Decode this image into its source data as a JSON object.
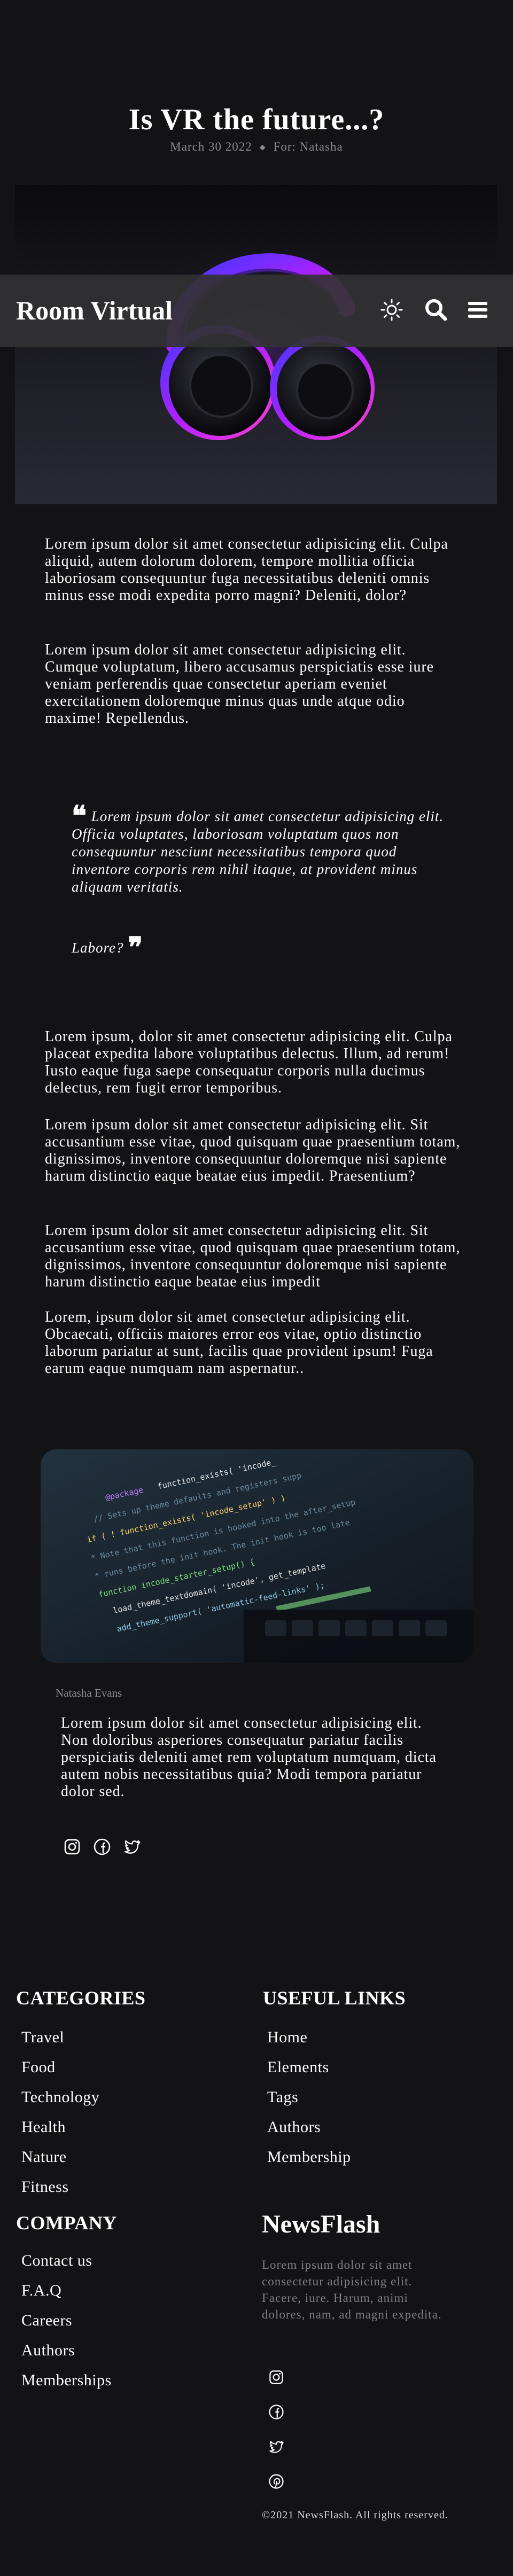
{
  "post": {
    "title": "Is VR the future...?",
    "date": "March 30 2022",
    "separator": "◆",
    "author_line": "For: Natasha"
  },
  "navbar": {
    "brand": "Room Virtual",
    "icons": [
      "theme-toggle-icon",
      "search-icon",
      "menu-icon"
    ]
  },
  "article": {
    "paragraphs": [
      "Lorem ipsum dolor sit amet consectetur adipisicing elit. Culpa aliquid, autem dolorum dolorem, tempore mollitia officia laboriosam consequuntur fuga necessitatibus deleniti omnis minus esse modi expedita porro magni? Deleniti, dolor?",
      "Lorem ipsum dolor sit amet consectetur adipisicing elit. Cumque voluptatum, libero accusamus perspiciatis esse iure veniam perferendis quae consectetur aperiam eveniet exercitationem doloremque minus quas unde atque odio maxime! Repellendus."
    ],
    "quote": "Lorem ipsum dolor sit amet consectetur adipisicing elit. Officia voluptates, laboriosam voluptatum quos non consequuntur nesciunt necessitatibus tempora quod inventore corporis rem nihil itaque, at provident minus aliquam veritatis.",
    "quote_end": "Labore?",
    "quote_open": "❝",
    "quote_close": "❞",
    "paragraphs2": [
      "Lorem ipsum, dolor sit amet consectetur adipisicing elit. Culpa placeat expedita labore voluptatibus delectus. Illum, ad rerum! Iusto eaque fuga saepe consequatur corporis nulla ducimus delectus, rem fugit error temporibus.",
      "Lorem ipsum dolor sit amet consectetur adipisicing elit. Sit accusantium esse vitae, quod quisquam quae praesentium totam, dignissimos, inventore consequuntur doloremque nisi sapiente harum distinctio eaque beatae eius impedit. Praesentium?",
      "Lorem ipsum dolor sit amet consectetur adipisicing elit. Sit accusantium esse vitae, quod quisquam quae praesentium totam, dignissimos, inventore consequuntur doloremque nisi sapiente harum distinctio eaque beatae eius impedit",
      "Lorem, ipsum dolor sit amet consectetur adipisicing elit. Obcaecati, officiis maiores error eos vitae, optio distinctio laborum pariatur at sunt, facilis quae provident ipsum! Fuga earum eaque numquam nam aspernatur.."
    ]
  },
  "author": {
    "name": "Natasha Evans",
    "bio": "Lorem ipsum dolor sit amet consectetur adipisicing elit. Non doloribus asperiores consequatur pariatur facilis perspiciatis deleniti amet rem voluptatum numquam, dicta autem nobis necessitatibus quia? Modi tempora pariatur dolor sed.",
    "social_icons": [
      "instagram-icon",
      "facebook-icon",
      "twitter-icon"
    ]
  },
  "footer": {
    "categories": {
      "heading": "CATEGORIES",
      "items": [
        "Travel",
        "Food",
        "Technology",
        "Health",
        "Nature",
        "Fitness"
      ]
    },
    "useful_links": {
      "heading": "USEFUL LINKS",
      "items": [
        "Home",
        "Elements",
        "Tags",
        "Authors",
        "Membership"
      ]
    },
    "company": {
      "heading": "COMPANY",
      "items": [
        "Contact us",
        "F.A.Q",
        "Careers",
        "Authors",
        "Memberships"
      ]
    },
    "newsletter": {
      "title": "NewsFlash",
      "text": "Lorem ipsum dolor sit amet consectetur adipisicing elit. Facere, iure. Harum, animi dolores, nam, ad magni expedita.",
      "icons": [
        "instagram-icon",
        "facebook-icon",
        "twitter-icon",
        "pinterest-icon"
      ]
    },
    "copyright": "©2021 NewsFlash. All rights reserved."
  },
  "colors": {
    "background": "#131316",
    "navbar": "#323234",
    "muted_text": "#8a8a90",
    "accent_purple": "#b020ff",
    "accent_blue": "#3a3aff"
  }
}
